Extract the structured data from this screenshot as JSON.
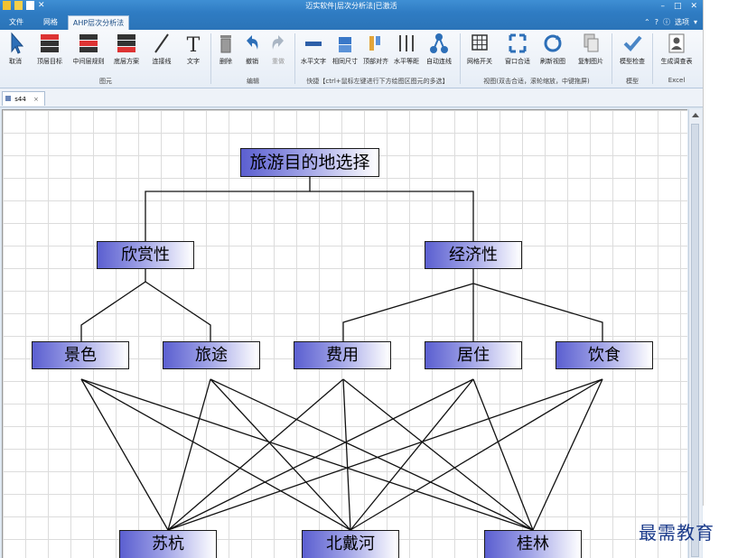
{
  "window": {
    "title": "迈实软件|层次分析法|已激活"
  },
  "tabs": {
    "file": "文件",
    "grid": "网格",
    "ahp": "AHP层次分析法",
    "options": "选项"
  },
  "ribbon": {
    "cancel": "取消",
    "top_goal": "顶层目标",
    "middle_rule": "中间层规则",
    "bottom_plan": "底层方案",
    "connect_line": "连接线",
    "text": "文字",
    "delete": "删除",
    "undo": "撤销",
    "redo": "重做",
    "horizontal_text": "水平文字",
    "same_size": "相同尺寸",
    "top_align": "顶部对齐",
    "horizontal_spacing": "水平等距",
    "auto_connect": "自动连线",
    "grid_toggle": "网格开关",
    "fit_window": "窗口合适",
    "refresh_view": "刷新视图",
    "copy_image": "复制图片",
    "model_check": "模型检查",
    "generate_survey": "生成调查表",
    "group_shapes": "图元",
    "group_edit": "编辑",
    "group_quick": "快捷【ctrl+鼠标左键进行下方绘图区图元的多选】",
    "group_view": "视图(双击合适，滚轮缩放，中键拖屏)",
    "group_model": "模型",
    "group_excel": "Excel"
  },
  "document": {
    "tab_label": "s44"
  },
  "diagram": {
    "goal": "旅游目的地选择",
    "criteria": [
      "欣赏性",
      "经济性"
    ],
    "subcriteria": [
      "景色",
      "旅途",
      "费用",
      "居住",
      "饮食"
    ],
    "alternatives": [
      "苏杭",
      "北戴河",
      "桂林"
    ]
  },
  "watermark": "最需教育",
  "colors": {
    "title_bar": "#2f7cc3",
    "node_fill_start": "#5b5fd0",
    "node_fill_end": "#ffffff"
  }
}
